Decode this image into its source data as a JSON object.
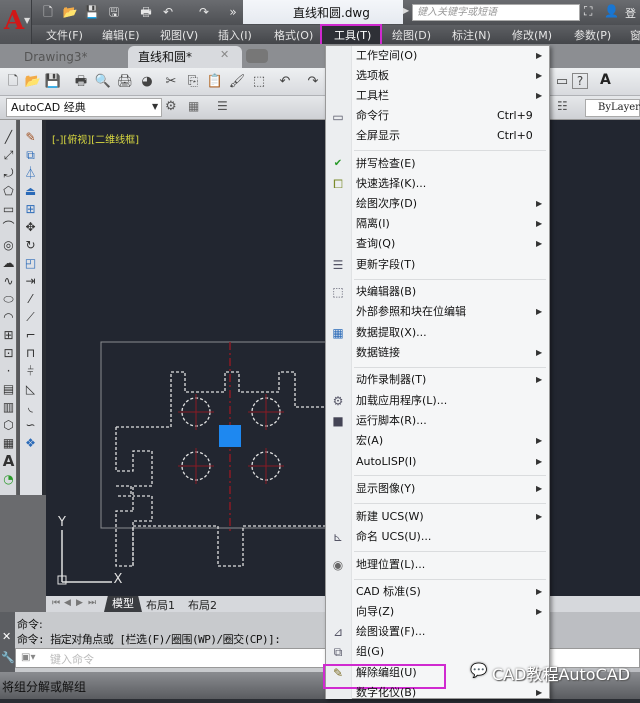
{
  "titlebar": {
    "document_title": "直线和圆.dwg",
    "search_placeholder": "键入关键字或短语",
    "login_label": "登"
  },
  "menubar": {
    "items": [
      {
        "label": "文件(F)"
      },
      {
        "label": "编辑(E)"
      },
      {
        "label": "视图(V)"
      },
      {
        "label": "插入(I)"
      },
      {
        "label": "格式(O)"
      },
      {
        "label": "工具(T)",
        "active": true
      },
      {
        "label": "绘图(D)"
      },
      {
        "label": "标注(N)"
      },
      {
        "label": "修改(M)"
      },
      {
        "label": "参数(P)"
      },
      {
        "label": "窗"
      }
    ]
  },
  "tabs": [
    {
      "label": "Drawing3*",
      "active": false
    },
    {
      "label": "直线和圆*",
      "active": true
    }
  ],
  "toolbar": {
    "workspace": "AutoCAD 经典",
    "linetype": "ByLayer"
  },
  "viewport": {
    "label": "[-][俯视][二维线框]",
    "ucs_x": "X",
    "ucs_y": "Y"
  },
  "layout_tabs": [
    {
      "label": "模型",
      "active": true
    },
    {
      "label": "布局1",
      "active": false
    },
    {
      "label": "布局2",
      "active": false
    }
  ],
  "command": {
    "history": [
      "命令:",
      "命令: 指定对角点或 [栏选(F)/圈围(WP)/圈交(CP)]:"
    ],
    "placeholder": "键入命令"
  },
  "status_text": "将组分解或解组",
  "tools_menu": {
    "items": [
      {
        "label": "工作空间(O)",
        "submenu": true,
        "icon": null
      },
      {
        "label": "选项板",
        "submenu": true,
        "icon": null
      },
      {
        "label": "工具栏",
        "submenu": true,
        "icon": null
      },
      {
        "label": "命令行",
        "shortcut": "Ctrl+9",
        "icon": "command-line-icon"
      },
      {
        "label": "全屏显示",
        "shortcut": "Ctrl+0",
        "icon": null
      },
      {
        "label": "拼写检查(E)",
        "icon": "spell-check-icon"
      },
      {
        "label": "快速选择(K)...",
        "icon": "quick-select-icon"
      },
      {
        "label": "绘图次序(D)",
        "submenu": true,
        "icon": null
      },
      {
        "label": "隔离(I)",
        "submenu": true,
        "icon": null
      },
      {
        "label": "查询(Q)",
        "submenu": true,
        "icon": null
      },
      {
        "label": "更新字段(T)",
        "icon": "update-field-icon"
      },
      {
        "label": "块编辑器(B)",
        "icon": "block-editor-icon"
      },
      {
        "label": "外部参照和块在位编辑",
        "submenu": true,
        "icon": null
      },
      {
        "label": "数据提取(X)...",
        "icon": "data-extraction-icon"
      },
      {
        "label": "数据链接",
        "submenu": true,
        "icon": null
      },
      {
        "label": "动作录制器(T)",
        "submenu": true,
        "icon": null
      },
      {
        "label": "加载应用程序(L)...",
        "icon": "load-app-icon"
      },
      {
        "label": "运行脚本(R)...",
        "icon": "run-script-icon"
      },
      {
        "label": "宏(A)",
        "submenu": true,
        "icon": null
      },
      {
        "label": "AutoLISP(I)",
        "submenu": true,
        "icon": null
      },
      {
        "label": "显示图像(Y)",
        "submenu": true,
        "icon": null
      },
      {
        "label": "新建 UCS(W)",
        "submenu": true,
        "icon": null
      },
      {
        "label": "命名 UCS(U)...",
        "icon": "named-ucs-icon"
      },
      {
        "label": "地理位置(L)...",
        "icon": "geolocation-icon"
      },
      {
        "label": "CAD 标准(S)",
        "submenu": true,
        "icon": null
      },
      {
        "label": "向导(Z)",
        "submenu": true,
        "icon": null
      },
      {
        "label": "绘图设置(F)...",
        "icon": "drafting-settings-icon"
      },
      {
        "label": "组(G)",
        "icon": "group-icon"
      },
      {
        "label": "解除编组(U)",
        "icon": "ungroup-icon",
        "highlighted": true
      },
      {
        "label": "数字化仪(B)",
        "submenu": true,
        "icon": null
      }
    ]
  },
  "watermark": "CAD教程AutoCAD",
  "colors": {
    "highlight": "#d02ad0",
    "canvas": "#222630",
    "selected_grip": "#1e88f0",
    "centerline": "#8a1a24",
    "viewport_label": "#d8d840"
  }
}
